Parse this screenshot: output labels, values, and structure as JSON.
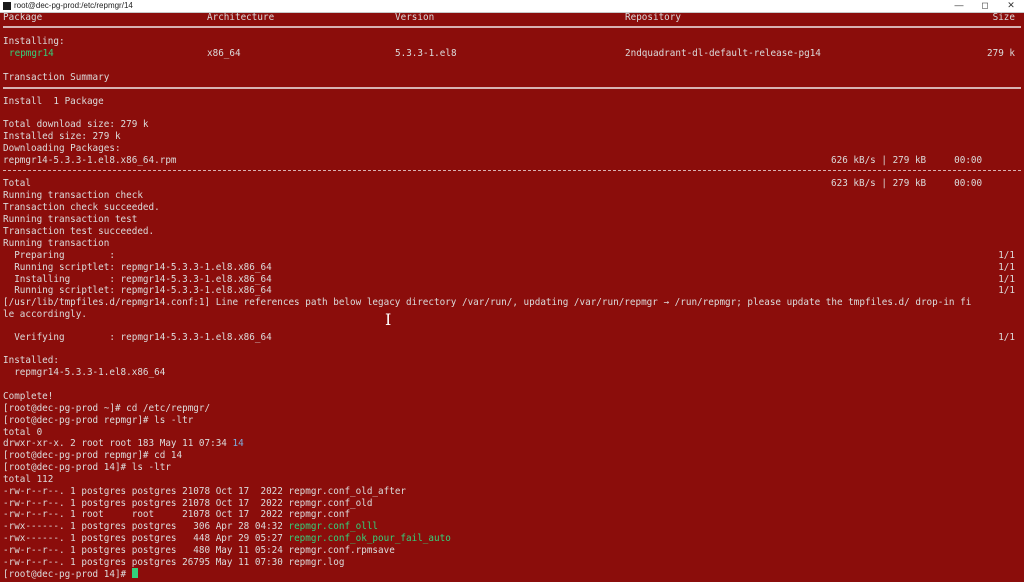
{
  "window": {
    "title": "root@dec-pg-prod:/etc/repmgr/14",
    "minimize_glyph": "—",
    "maximize_glyph": "◻",
    "close_glyph": "✕",
    "app_icon": "terminal-icon"
  },
  "colors": {
    "background": "#8b0d0b",
    "text": "#dcdcdc",
    "highlight": "#33d17a",
    "directory": "#7fb0e0"
  },
  "header": {
    "package": "Package",
    "architecture": "Architecture",
    "version": "Version",
    "repository": "Repository",
    "size": "Size"
  },
  "installing_label": "Installing:",
  "package_row": {
    "name": "repmgr14",
    "arch": "x86_64",
    "version": "5.3.3-1.el8",
    "repo": "2ndquadrant-dl-default-release-pg14",
    "size": "279 k"
  },
  "summary_label": "Transaction Summary",
  "install_count": "Install  1 Package",
  "download_size": "Total download size: 279 k",
  "installed_size": "Installed size: 279 k",
  "downloading": "Downloading Packages:",
  "rpm_row": {
    "file": "repmgr14-5.3.3-1.el8.x86_64.rpm",
    "stats": "626 kB/s | 279 kB     00:00"
  },
  "total_row": {
    "label": "Total",
    "stats": "623 kB/s | 279 kB     00:00"
  },
  "transaction_lines": [
    "Running transaction check",
    "Transaction check succeeded.",
    "Running transaction test",
    "Transaction test succeeded.",
    "Running transaction"
  ],
  "steps": [
    {
      "text": "  Preparing        :",
      "count": "1/1"
    },
    {
      "text": "  Running scriptlet: repmgr14-5.3.3-1.el8.x86_64",
      "count": "1/1"
    },
    {
      "text": "  Installing       : repmgr14-5.3.3-1.el8.x86_64",
      "count": "1/1"
    },
    {
      "text": "  Running scriptlet: repmgr14-5.3.3-1.el8.x86_64",
      "count": "1/1"
    }
  ],
  "warning_line1": "[/usr/lib/tmpfiles.d/repmgr14.conf:1] Line references path below legacy directory /var/run/, updating /var/run/repmgr → /run/repmgr; please update the tmpfiles.d/ drop-in fi",
  "warning_line2": "le accordingly.",
  "verifying": {
    "text": "  Verifying        : repmgr14-5.3.3-1.el8.x86_64",
    "count": "1/1"
  },
  "installed_label": "Installed:",
  "installed_pkg": "  repmgr14-5.3.3-1.el8.x86_64",
  "complete": "Complete!",
  "cmd1": "[root@dec-pg-prod ~]# cd /etc/repmgr/",
  "cmd2": "[root@dec-pg-prod repmgr]# ls -ltr",
  "total0": "total 0",
  "dir_line": {
    "prefix": "drwxr-xr-x. 2 root root 183 May 11 07:34 ",
    "name": "14"
  },
  "cmd3": "[root@dec-pg-prod repmgr]# cd 14",
  "cmd4": "[root@dec-pg-prod 14]# ls -ltr",
  "total112": "total 112",
  "files": [
    {
      "prefix": "-rw-r--r--. 1 postgres postgres 21078 Oct 17  2022 ",
      "name": "repmgr.conf_old_after",
      "exec": false
    },
    {
      "prefix": "-rw-r--r--. 1 postgres postgres 21078 Oct 17  2022 ",
      "name": "repmgr.conf_old",
      "exec": false
    },
    {
      "prefix": "-rw-r--r--. 1 root     root     21078 Oct 17  2022 ",
      "name": "repmgr.conf",
      "exec": false
    },
    {
      "prefix": "-rwx------. 1 postgres postgres   306 Apr 28 04:32 ",
      "name": "repmgr.conf_olll",
      "exec": true
    },
    {
      "prefix": "-rwx------. 1 postgres postgres   448 Apr 29 05:27 ",
      "name": "repmgr.conf_ok_pour_fail_auto",
      "exec": true
    },
    {
      "prefix": "-rw-r--r--. 1 postgres postgres   480 May 11 05:24 ",
      "name": "repmgr.conf.rpmsave",
      "exec": false
    },
    {
      "prefix": "-rw-r--r--. 1 postgres postgres 26795 May 11 07:30 ",
      "name": "repmgr.log",
      "exec": false
    }
  ],
  "prompt": "[root@dec-pg-prod 14]# "
}
